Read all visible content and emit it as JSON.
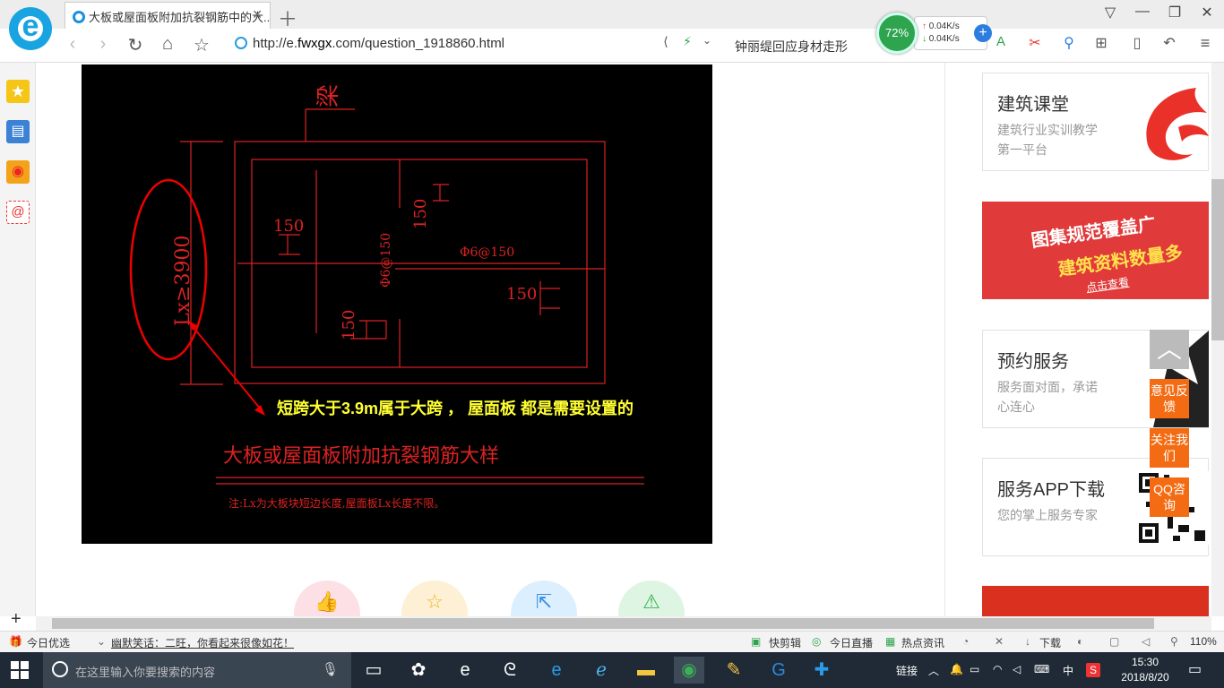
{
  "browser": {
    "tab_title": "大板或屋面板附加抗裂钢筋中的大...",
    "url_prefix": "http://e.",
    "url_domain": "fwxgx",
    "url_suffix": ".com/question_1918860.html",
    "hot_search": "钟丽缇回应身材走形",
    "cpu_percent": "72%",
    "upload_speed": "0.04K/s",
    "download_speed": "0.04K/s"
  },
  "drawing": {
    "beam_label": "梁",
    "span_label": "Lx≥3900",
    "dim_150_a": "150",
    "dim_150_b": "150",
    "dim_150_c": "150",
    "dim_150_d": "150",
    "rebar_v": "Φ6@150",
    "rebar_h": "Φ6@150",
    "annotation": "短跨大于3.9m属于大跨 ， 屋面板 都是需要设置的",
    "title": "大板或屋面板附加抗裂钢筋大样",
    "note": "注:Lx为大板块短边长度,屋面板Lx长度不限。"
  },
  "sidebar": {
    "cards": [
      {
        "title": "建筑课堂",
        "subtitle": "建筑行业实训教学第一平台"
      },
      {
        "title": "预约服务",
        "subtitle": "服务面对面，承诺心连心"
      },
      {
        "title": "服务APP下载",
        "subtitle": "您的掌上服务专家"
      }
    ],
    "banner_line1": "图集规范覆盖广",
    "banner_line2": "建筑资料数量多",
    "banner_link": "点击查看"
  },
  "float_buttons": {
    "feedback": "意见反馈",
    "follow": "关注我们",
    "qq": "QQ咨询"
  },
  "statusbar": {
    "today": "今日优选",
    "joke": "幽默笑话：二旺，你看起来很像如花！",
    "kuaijianji": "快剪辑",
    "live": "今日直播",
    "news": "热点资讯",
    "download": "下载",
    "zoom": "110%"
  },
  "taskbar": {
    "search_placeholder": "在这里输入你要搜索的内容",
    "link_label": "链接",
    "ime": "中",
    "time": "15:30",
    "date": "2018/8/20"
  }
}
